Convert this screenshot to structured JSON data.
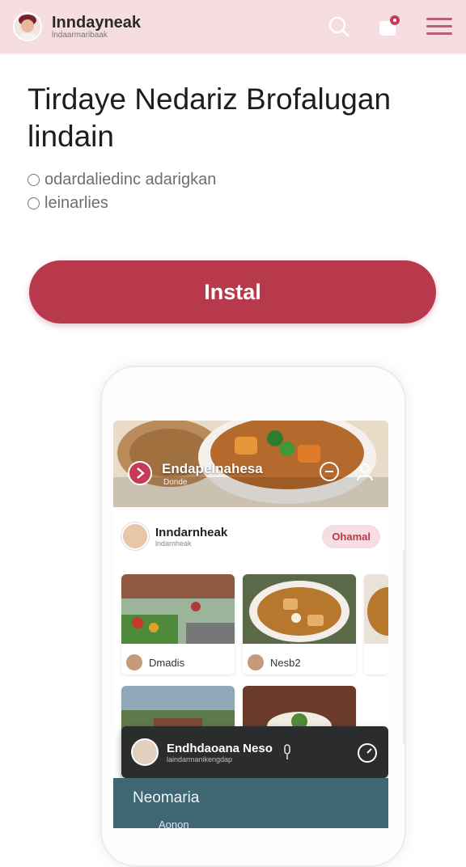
{
  "topbar": {
    "name": "Inndayneak",
    "subtitle": "lndaarmaribaak",
    "notification_badge_color": "#c63b58"
  },
  "headline": "Tirdaye Nedariz Brofalugan lindain",
  "meta": {
    "line1": "odardaliedinc adarigkan",
    "line2": "leinarlies"
  },
  "install_button": {
    "label": "Instal",
    "color": "#b8394b"
  },
  "screen": {
    "hero": {
      "title": "Endapelnahesa",
      "subtitle": "Donde"
    },
    "profile": {
      "name": "Inndarnheak",
      "subtitle": "lndarnheak",
      "action_label": "Ohamal"
    },
    "cards": [
      {
        "label": "Dmadis"
      },
      {
        "label": "Nesb2"
      },
      {
        "label": ""
      },
      {
        "label": ""
      }
    ],
    "player": {
      "title": "Endhdaoana Neso",
      "subtitle": "laindarmanikengdap"
    },
    "bottom": {
      "title": "Neomaria",
      "subtitle": "Aonon"
    }
  }
}
